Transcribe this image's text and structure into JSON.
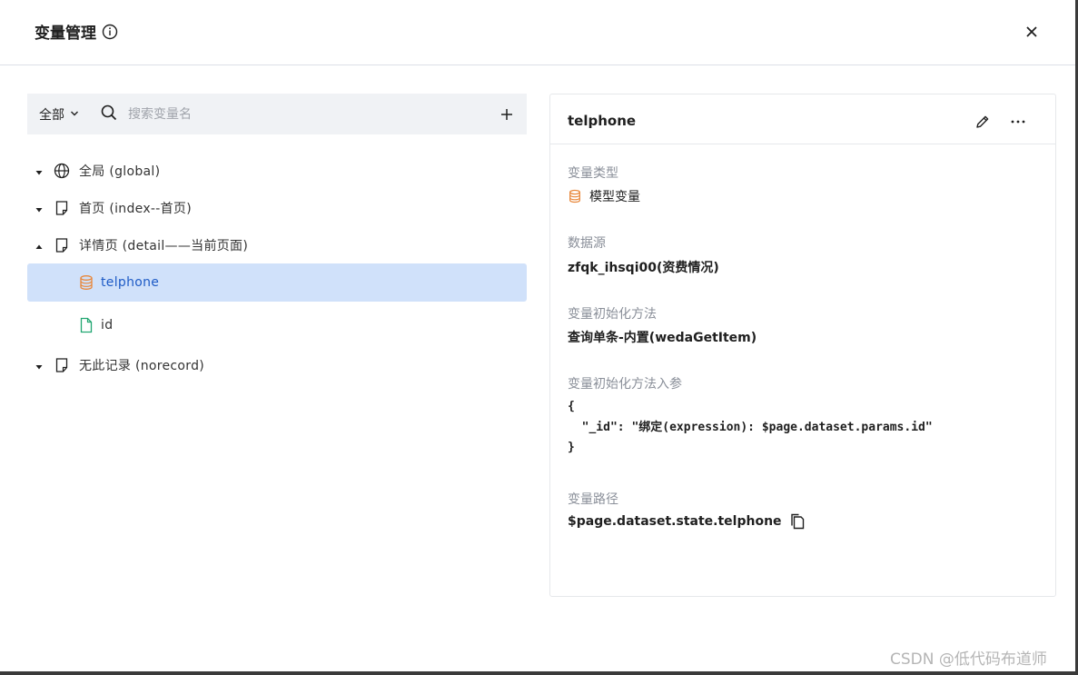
{
  "dialog": {
    "title": "变量管理",
    "icons": {
      "info": "info-circle-icon",
      "close": "close-icon"
    }
  },
  "toolbar": {
    "scope_label": "全部",
    "search_placeholder": "搜索变量名",
    "icons": {
      "dropdown": "chevron-down-icon",
      "search": "search-icon",
      "add": "plus-icon"
    }
  },
  "tree": {
    "nodes": [
      {
        "label": "全局 (global)",
        "icon": "globe-icon",
        "expanded": false
      },
      {
        "label": "首页 (index--首页)",
        "icon": "page-icon",
        "expanded": false
      },
      {
        "label": "详情页 (detail——当前页面)",
        "icon": "page-icon",
        "expanded": true,
        "children": [
          {
            "label": "telphone",
            "icon": "database-icon",
            "selected": true
          },
          {
            "label": "id",
            "icon": "file-icon",
            "selected": false
          }
        ]
      },
      {
        "label": "无此记录 (norecord)",
        "icon": "page-icon",
        "expanded": false
      }
    ]
  },
  "detail": {
    "title": "telphone",
    "fields": {
      "type_label": "变量类型",
      "type_value": "模型变量",
      "source_label": "数据源",
      "source_value": "zfqk_ihsqi00(资费情况)",
      "init_method_label": "变量初始化方法",
      "init_method_value": "查询单条-内置(wedaGetItem)",
      "init_params_label": "变量初始化方法入参",
      "init_params_code": "{\n  \"_id\": \"绑定(expression): $page.dataset.params.id\"\n}",
      "path_label": "变量路径",
      "path_value": "$page.dataset.state.telphone"
    },
    "icons": {
      "edit": "pencil-icon",
      "more": "more-horizontal-icon",
      "copy": "copy-icon",
      "type": "database-icon"
    }
  },
  "colors": {
    "selected_bg": "#d0e1fa",
    "selected_text": "#1e5bc6",
    "model_icon": "#e8873a",
    "file_icon": "#21a671"
  },
  "watermark": "CSDN @低代码布道师"
}
